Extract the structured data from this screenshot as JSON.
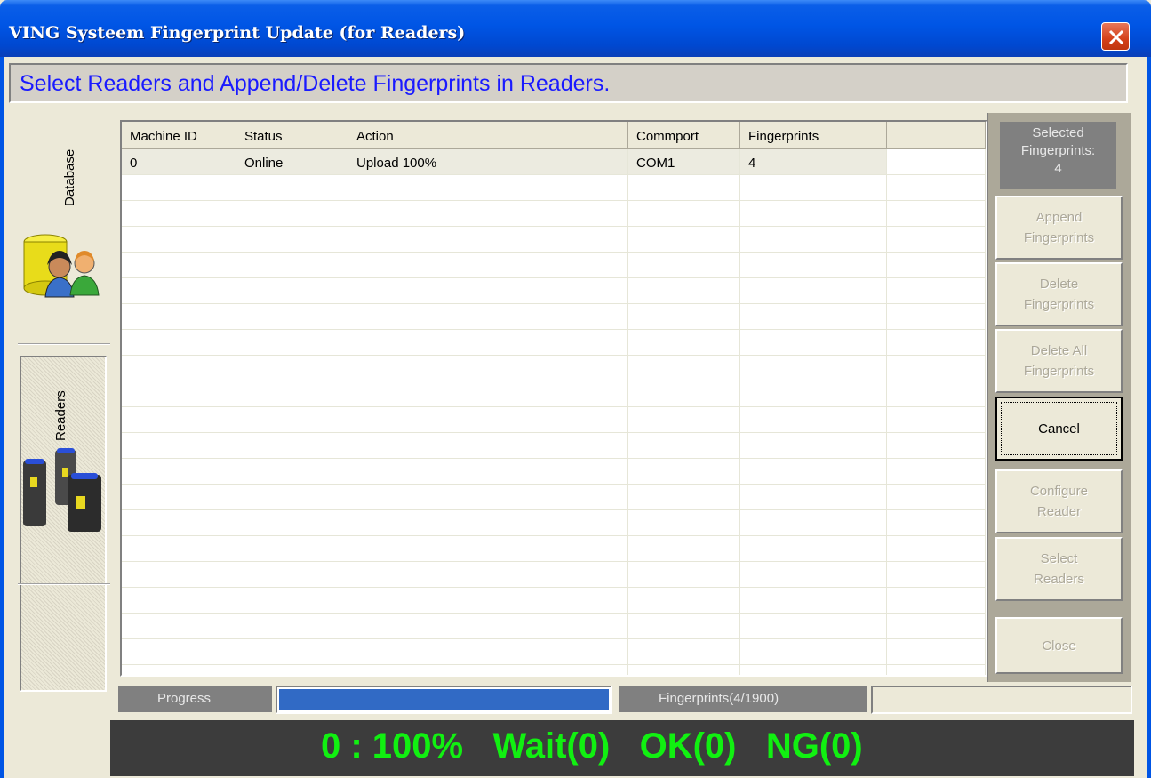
{
  "window": {
    "title": "VING Systeem Fingerprint Update (for Readers)",
    "close_icon": "close-icon"
  },
  "header": {
    "text": "Select Readers and Append/Delete Fingerprints in Readers."
  },
  "nav": {
    "database_label": "Database",
    "database_icon": "database-users-icon",
    "readers_label": "Readers",
    "readers_icon": "fingerprint-readers-icon"
  },
  "table": {
    "columns": [
      "Machine ID",
      "Status",
      "Action",
      "Commport",
      "Fingerprints",
      ""
    ],
    "rows": [
      {
        "machine_id": "0",
        "status": "Online",
        "action": "Upload 100%",
        "commport": "COM1",
        "fingerprints": "4"
      }
    ]
  },
  "sidebar": {
    "selected_line1": "Selected",
    "selected_line2": "Fingerprints:",
    "selected_count": "4",
    "buttons": {
      "append_l1": "Append",
      "append_l2": "Fingerprints",
      "delete_l1": "Delete",
      "delete_l2": "Fingerprints",
      "delete_all_l1": "Delete All",
      "delete_all_l2": "Fingerprints",
      "cancel": "Cancel",
      "configure_l1": "Configure",
      "configure_l2": "Reader",
      "select_l1": "Select",
      "select_l2": "Readers",
      "close": "Close"
    }
  },
  "progress": {
    "label": "Progress",
    "fraction": 1.0,
    "fingerprints_label": "Fingerprints(4/1900)"
  },
  "status": {
    "text": "0 : 100%   Wait(0)   OK(0)   NG(0)"
  },
  "colors": {
    "titlebar": "#0055e5",
    "header_text": "#1a1aff",
    "status_text": "#11f011",
    "progress_fill": "#316ac5"
  }
}
